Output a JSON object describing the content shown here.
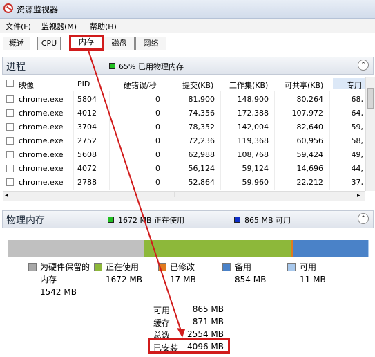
{
  "window": {
    "title": "资源监视器"
  },
  "menu": [
    {
      "label": "文件(F)"
    },
    {
      "label": "监视器(M)"
    },
    {
      "label": "帮助(H)"
    }
  ],
  "tabs": [
    {
      "label": "概述",
      "active": false
    },
    {
      "label": "CPU",
      "active": false
    },
    {
      "label": "内存",
      "active": true
    },
    {
      "label": "磁盘",
      "active": false
    },
    {
      "label": "网络",
      "active": false
    }
  ],
  "process_section": {
    "title": "进程",
    "legend": {
      "text": "65% 已用物理内存",
      "color": "#22c022"
    },
    "columns": [
      "映像",
      "PID",
      "硬错误/秒",
      "提交(KB)",
      "工作集(KB)",
      "可共享(KB)",
      "专用"
    ],
    "rows": [
      {
        "image": "chrome.exe",
        "pid": "5804",
        "hard_faults": "0",
        "commit": "81,900",
        "working_set": "148,900",
        "shareable": "80,264",
        "private": "68,"
      },
      {
        "image": "chrome.exe",
        "pid": "4012",
        "hard_faults": "0",
        "commit": "74,356",
        "working_set": "172,388",
        "shareable": "107,972",
        "private": "64,"
      },
      {
        "image": "chrome.exe",
        "pid": "3704",
        "hard_faults": "0",
        "commit": "78,352",
        "working_set": "142,004",
        "shareable": "82,640",
        "private": "59,"
      },
      {
        "image": "chrome.exe",
        "pid": "2752",
        "hard_faults": "0",
        "commit": "72,236",
        "working_set": "119,368",
        "shareable": "60,956",
        "private": "58,"
      },
      {
        "image": "chrome.exe",
        "pid": "5608",
        "hard_faults": "0",
        "commit": "62,988",
        "working_set": "108,768",
        "shareable": "59,424",
        "private": "49,"
      },
      {
        "image": "chrome.exe",
        "pid": "4072",
        "hard_faults": "0",
        "commit": "56,124",
        "working_set": "59,124",
        "shareable": "14,696",
        "private": "44,"
      },
      {
        "image": "chrome.exe",
        "pid": "2788",
        "hard_faults": "0",
        "commit": "52,864",
        "working_set": "59,960",
        "shareable": "22,212",
        "private": "37,"
      }
    ],
    "hscroll_thumb": "III"
  },
  "memory_section": {
    "title": "物理内存",
    "legend_in_use": {
      "text": "1672 MB 正在使用",
      "color": "#22c022"
    },
    "legend_available": {
      "text": "865 MB 可用",
      "color": "#1030c8"
    },
    "bar_segments": [
      {
        "name": "hardware_reserved",
        "mb": 1542,
        "color": "#c0c0c0"
      },
      {
        "name": "in_use",
        "mb": 1672,
        "color": "#8db83a"
      },
      {
        "name": "modified",
        "mb": 17,
        "color": "#e07b1f"
      },
      {
        "name": "standby",
        "mb": 854,
        "color": "#4a82c8"
      },
      {
        "name": "free",
        "mb": 11,
        "color": "#a8c8ec"
      }
    ],
    "legend": [
      {
        "label": "为硬件保留的",
        "label2": "内存",
        "value": "1542 MB",
        "color": "#a8a8a8"
      },
      {
        "label": "正在使用",
        "value": "1672 MB",
        "color": "#8db83a"
      },
      {
        "label": "已修改",
        "value": "17 MB",
        "color": "#e07b1f"
      },
      {
        "label": "备用",
        "value": "854 MB",
        "color": "#4a82c8"
      },
      {
        "label": "可用",
        "value": "11 MB",
        "color": "#a8c8ec"
      }
    ],
    "stats": [
      {
        "label": "可用",
        "value": "865 MB"
      },
      {
        "label": "缓存",
        "value": "871 MB"
      },
      {
        "label": "总数",
        "value": "2554 MB"
      },
      {
        "label": "已安装",
        "value": "4096 MB"
      }
    ]
  },
  "annotation": {
    "color": "#d11b1b"
  }
}
